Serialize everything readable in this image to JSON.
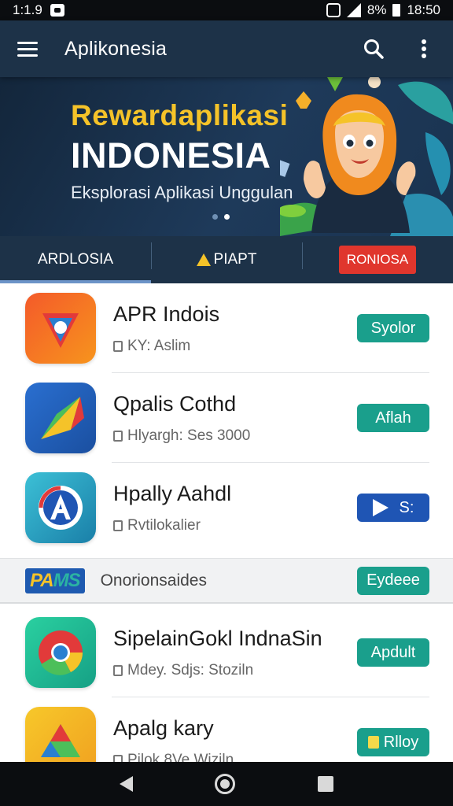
{
  "status_bar": {
    "left_time": "1:1.9",
    "battery_percent": "8%",
    "clock": "18:50"
  },
  "app_bar": {
    "title": "Aplikonesia",
    "search_icon": "search-icon",
    "more_icon": "more-vert-icon"
  },
  "banner": {
    "title_line1": "Rewardaplikasi",
    "title_line2": "INDONESIA",
    "subtitle": "Eksplorasi Aplikasi Unggulan",
    "colors": {
      "title_line1": "#f5c329",
      "title_line2": "#ffffff"
    }
  },
  "tabs": [
    {
      "label": "ARDLOSIA",
      "active": true
    },
    {
      "label": "PIAPT",
      "active": false
    },
    {
      "label": "RONIOSA",
      "active": false
    }
  ],
  "apps": [
    {
      "title": "APR Indois",
      "subtitle": "KY: Aslim",
      "button": "Syolor"
    },
    {
      "title": "Qpalis Cothd",
      "subtitle": "Hlyargh: Ses 3000",
      "button": "Aflah"
    },
    {
      "title": "Hpally Aahdl",
      "subtitle": "Rvtilokalier",
      "button": "S:"
    }
  ],
  "promo": {
    "logo_left": "PA",
    "logo_right": "MS",
    "text": "Onorionsaides",
    "button": "Eydeee"
  },
  "apps_more": [
    {
      "title": "SipelainGokl IndnaSin",
      "subtitle": "Mdey. Sdjs: Stoziln",
      "button": "Apdult"
    },
    {
      "title": "Apalg kary",
      "subtitle": "Pilok 8Ve Wiziln",
      "button": "Rlloy"
    }
  ],
  "colors": {
    "primary": "#1d3248",
    "accent_button": "#1a9f8c",
    "blue_button": "#1f55b4",
    "badge_red": "#e0362d"
  }
}
